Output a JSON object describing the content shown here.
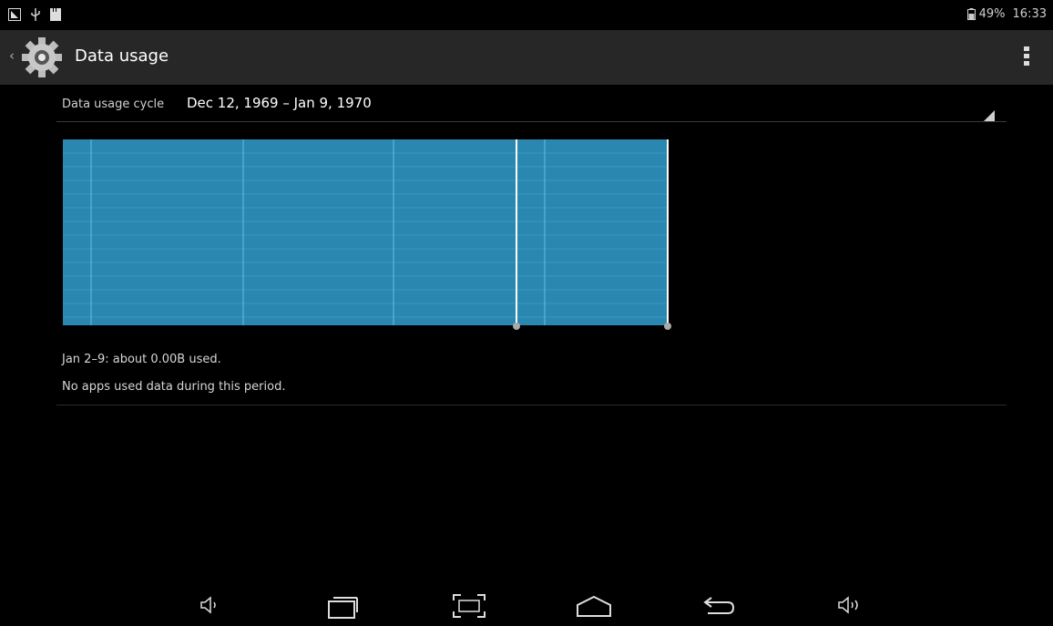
{
  "status_bar": {
    "icons": [
      "screenshot-icon",
      "usb-icon",
      "sd-card-icon"
    ],
    "battery_percent": "49%",
    "time": "16:33"
  },
  "action_bar": {
    "title": "Data usage",
    "icon": "settings-gear-icon"
  },
  "cycle": {
    "label": "Data usage cycle",
    "value": "Dec 12, 1969 – Jan 9, 1970"
  },
  "chart_data": {
    "type": "area",
    "fill_color": "#2a88b0",
    "grid_color": "#3fa0c8",
    "limit_marker_color": "#ffffff",
    "selected_range_start": 0.75,
    "selected_range_end": 1.0
  },
  "summary": {
    "usage_text": "Jan 2–9: about 0.00B used.",
    "apps_text": "No apps used data during this period."
  },
  "nav_bar": {
    "buttons": [
      "volume-down-icon",
      "recent-apps-icon",
      "screenshot-frame-icon",
      "home-icon",
      "back-icon",
      "volume-up-icon"
    ]
  },
  "colors": {
    "background": "#000000",
    "action_bar": "#272727",
    "accent": "#33b5e5"
  }
}
